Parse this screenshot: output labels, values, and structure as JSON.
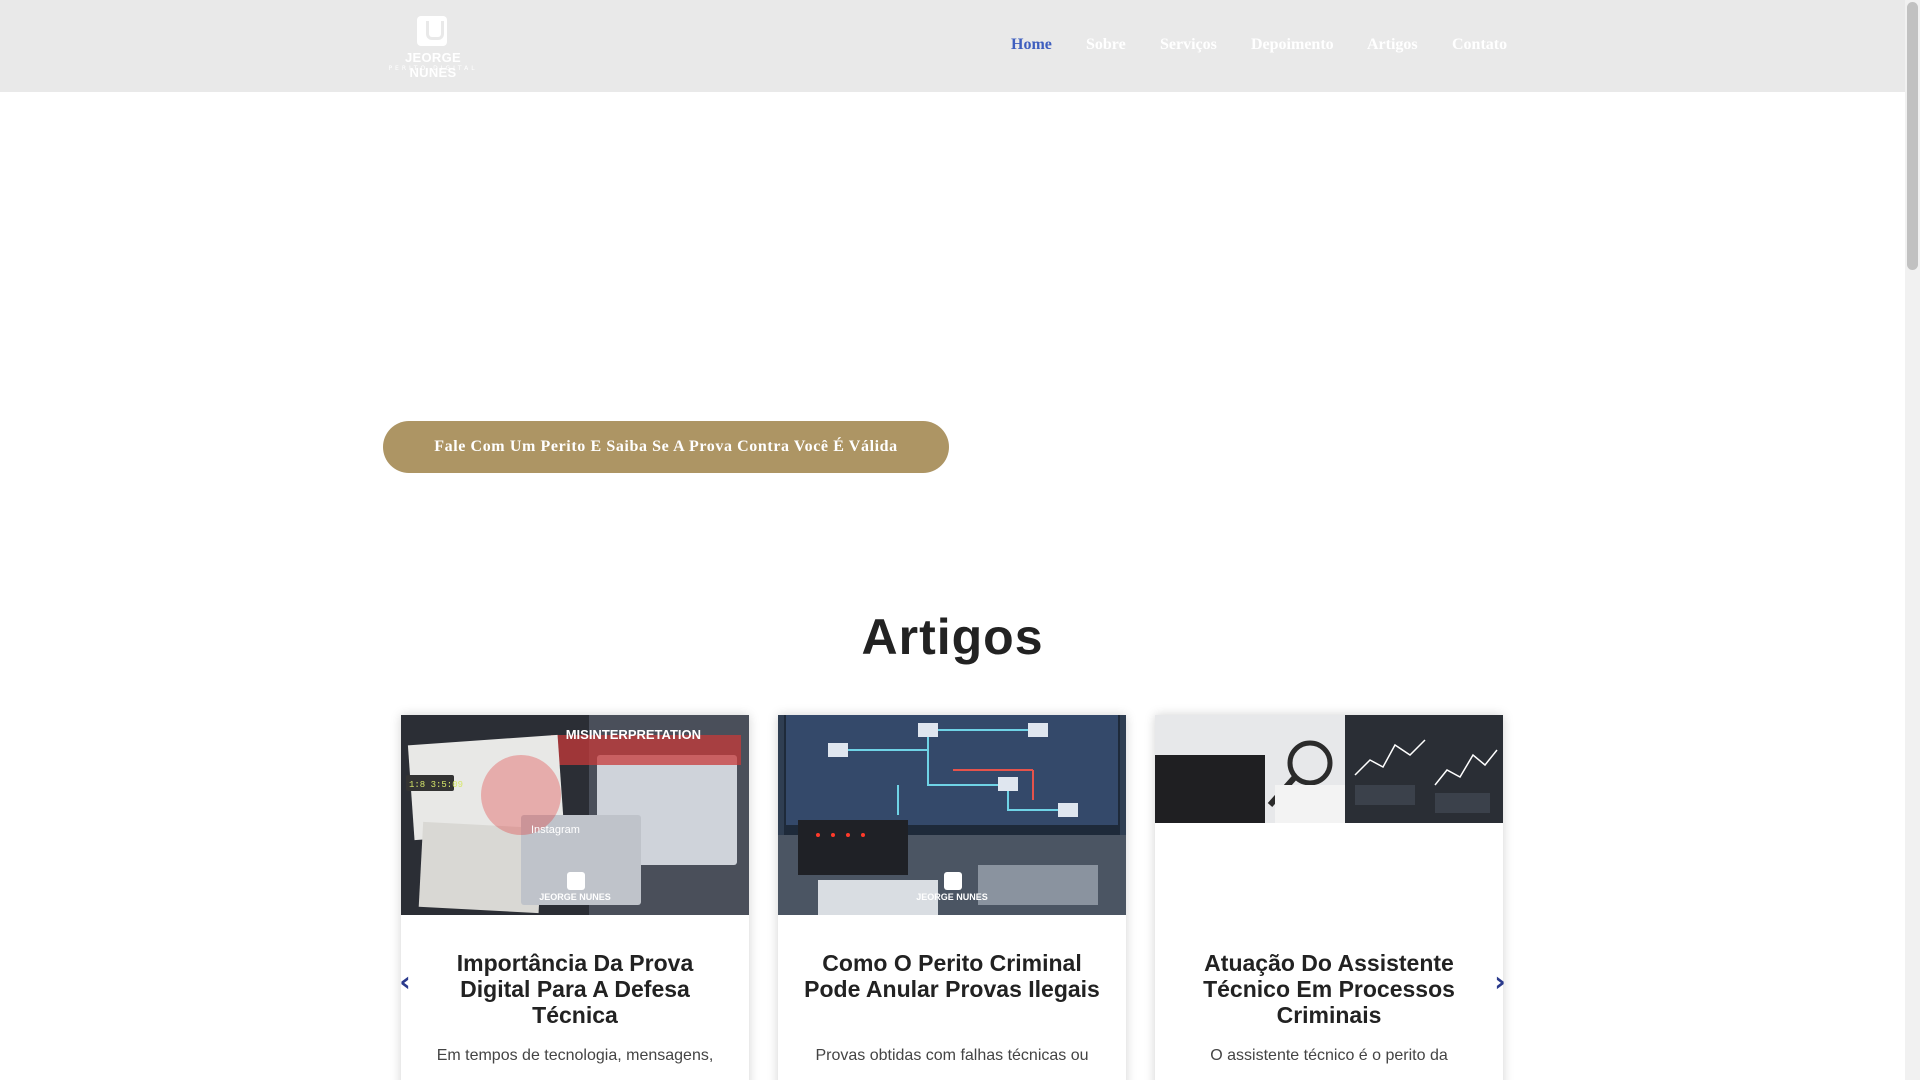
{
  "header": {
    "logo_name": "JEORGE NUNES",
    "logo_sub": "PERITO DIGITAL",
    "nav": [
      {
        "label": "Home",
        "active": true
      },
      {
        "label": "Sobre"
      },
      {
        "label": "Serviços"
      },
      {
        "label": "Depoimento"
      },
      {
        "label": "Artigos"
      },
      {
        "label": "Contato"
      }
    ]
  },
  "hero": {
    "cta_label": "Fale Com Um Perito E Saiba Se A Prova Contra Você É Válida"
  },
  "articles": {
    "heading": "Artigos",
    "cards": [
      {
        "title": "Importância Da Prova Digital Para A Defesa Técnica",
        "excerpt": "Em tempos de tecnologia, mensagens,",
        "image_text_1": "MISINTERPRETATION",
        "image_text_2": "Instagram",
        "image_text_3": "1:8 3:5:09",
        "watermark": "JEORGE NUNES"
      },
      {
        "title": "Como O Perito Criminal Pode Anular Provas Ilegais",
        "excerpt": "Provas obtidas com falhas técnicas ou",
        "watermark": "JEORGE NUNES"
      },
      {
        "title": "Atuação Do Assistente Técnico Em Processos Criminais",
        "excerpt": "O assistente técnico é o perito da"
      }
    ],
    "prev_icon": "chevron-left-icon",
    "next_icon": "chevron-right-icon"
  },
  "colors": {
    "header_bg": "#e9e9e9",
    "nav_active": "#3f5fbf",
    "cta_bg": "#ad9564",
    "arrow": "#2a3a8c"
  }
}
